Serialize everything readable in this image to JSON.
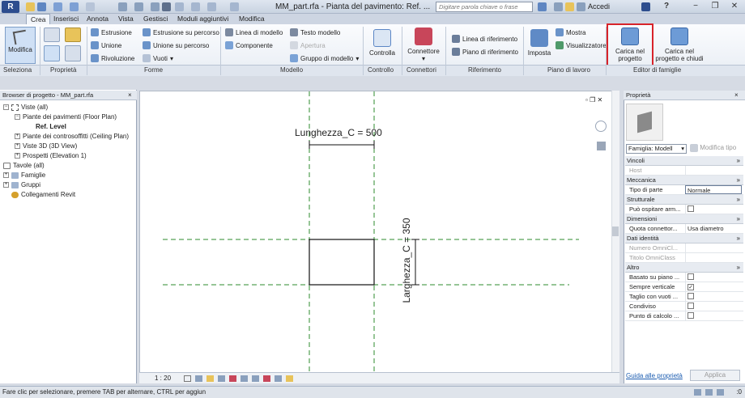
{
  "app": {
    "logo": "R",
    "window_title": "MM_part.rfa - Pianta del pavimento: Ref. ...",
    "search_placeholder": "Digitare parola chiave o frase",
    "signin_label": "Accedi",
    "help_label": "?"
  },
  "tabs": [
    "Crea",
    "Inserisci",
    "Annota",
    "Vista",
    "Gestisci",
    "Moduli aggiuntivi",
    "Modifica"
  ],
  "ribbon": {
    "modifica_label": "Modifica",
    "forme_items": [
      "Estrusione",
      "Unione",
      "Rivoluzione",
      "Estrusione su percorso",
      "Unione su percorso",
      "Vuoti"
    ],
    "modello_items": [
      "Linea di modello",
      "Componente",
      "Testo modello",
      "Apertura",
      "Gruppo di modello"
    ],
    "controllo_label": "Controlla",
    "connettore_label": "Connettore",
    "riferimento_items": [
      "Linea di riferimento",
      "Piano di riferimento"
    ],
    "imposta_label": "Imposta",
    "piano_items": [
      "Mostra",
      "Visualizzatore"
    ],
    "carica_progetto_label": "Carica nel progetto",
    "carica_chiudi_label": "Carica nel progetto e chiudi",
    "panel_labels": [
      "Seleziona",
      "Proprietà",
      "Forme",
      "Modello",
      "Controllo",
      "Connettori",
      "Riferimento",
      "Piano di lavoro",
      "Editor di famiglie"
    ]
  },
  "browser": {
    "title": "Browser di progetto - MM_part.rfa",
    "close_label": "×",
    "tree": [
      {
        "label": "Viste (all)",
        "expander": "−"
      },
      {
        "label": "Piante dei pavimenti (Floor Plan)",
        "expander": "−"
      },
      {
        "label": "Ref. Level",
        "expander": ""
      },
      {
        "label": "Piante dei controsoffitti (Ceiling Plan)",
        "expander": "+"
      },
      {
        "label": "Viste 3D (3D View)",
        "expander": "+"
      },
      {
        "label": "Prospetti (Elevation 1)",
        "expander": "+"
      },
      {
        "label": "Tavole (all)",
        "expander": ""
      },
      {
        "label": "Famiglie",
        "expander": "+"
      },
      {
        "label": "Gruppi",
        "expander": "+"
      },
      {
        "label": "Collegamenti Revit",
        "expander": ""
      }
    ]
  },
  "canvas": {
    "dim_length": "Lunghezza_C = 500",
    "dim_width": "Larghezza_C = 350",
    "scale": "1 : 20"
  },
  "properties": {
    "title": "Proprietà",
    "close_label": "×",
    "family_select": "Famiglia: Modell",
    "edit_type": "Modifica tipo",
    "groups": [
      {
        "name": "Vincoli",
        "rows": [
          {
            "name": "Host",
            "value": "",
            "grey": true
          }
        ]
      },
      {
        "name": "Meccanica",
        "rows": [
          {
            "name": "Tipo di parte",
            "value": "Normale"
          }
        ]
      },
      {
        "name": "Strutturale",
        "rows": [
          {
            "name": "Può ospitare arm...",
            "value": "",
            "check": "empty"
          }
        ]
      },
      {
        "name": "Dimensioni",
        "rows": [
          {
            "name": "Quota connettor...",
            "value": "Usa diametro"
          }
        ]
      },
      {
        "name": "Dati identità",
        "rows": [
          {
            "name": "Numero OmniCl...",
            "value": "",
            "grey": true
          },
          {
            "name": "Titolo OmniClass",
            "value": "",
            "grey": true
          }
        ]
      },
      {
        "name": "Altro",
        "rows": [
          {
            "name": "Basato su piano ...",
            "value": "",
            "check": "empty"
          },
          {
            "name": "Sempre verticale",
            "value": "",
            "check": "checked"
          },
          {
            "name": "Taglio con vuoti ...",
            "value": "",
            "check": "empty"
          },
          {
            "name": "Condiviso",
            "value": "",
            "check": "empty"
          },
          {
            "name": "Punto di calcolo ...",
            "value": "",
            "check": "empty"
          }
        ]
      }
    ],
    "help_link": "Guida alle proprietà",
    "apply_label": "Applica"
  },
  "status": {
    "text": "Fare clic per selezionare, premere TAB per alternare, CTRL per aggiun",
    "right": ":0"
  },
  "colors": {
    "highlight": "#d8232a",
    "dashed_line": "#2e8b2e",
    "link": "#1b5cb0"
  }
}
